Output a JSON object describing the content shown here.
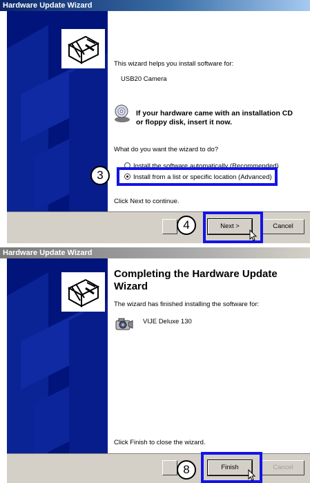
{
  "wizard1": {
    "title": "Hardware Update Wizard",
    "intro": "This wizard helps you install software for:",
    "device": "USB20 Camera",
    "cd_prompt_line1": "If your hardware came with an installation CD",
    "cd_prompt_line2": "or floppy disk, insert it now.",
    "question": "What do you want the wizard to do?",
    "options": [
      {
        "label": "Install the software automatically (Recommended)",
        "selected": false
      },
      {
        "label": "Install from a list or specific location (Advanced)",
        "selected": true
      }
    ],
    "continue_text": "Click Next to continue.",
    "buttons": {
      "next": "Next >",
      "cancel": "Cancel"
    }
  },
  "wizard2": {
    "title": "Hardware Update Wizard",
    "heading_line1": "Completing the Hardware Update",
    "heading_line2": "Wizard",
    "finished_text": "The wizard has finished installing the software for:",
    "device": "VIJE Deluxe 130",
    "close_text": "Click Finish to close the wizard.",
    "buttons": {
      "finish": "Finish",
      "cancel": "Cancel"
    }
  },
  "annotations": {
    "step3": "3",
    "step4": "4",
    "step8": "8"
  },
  "colors": {
    "highlight": "#1414e6",
    "sidebar": "#00147b",
    "titlebar_active": "#0a246a",
    "button_face": "#d4d0c8"
  },
  "icons": [
    "hardware-wizard-logo-icon",
    "cd-icon",
    "camera-icon",
    "cursor-icon"
  ]
}
